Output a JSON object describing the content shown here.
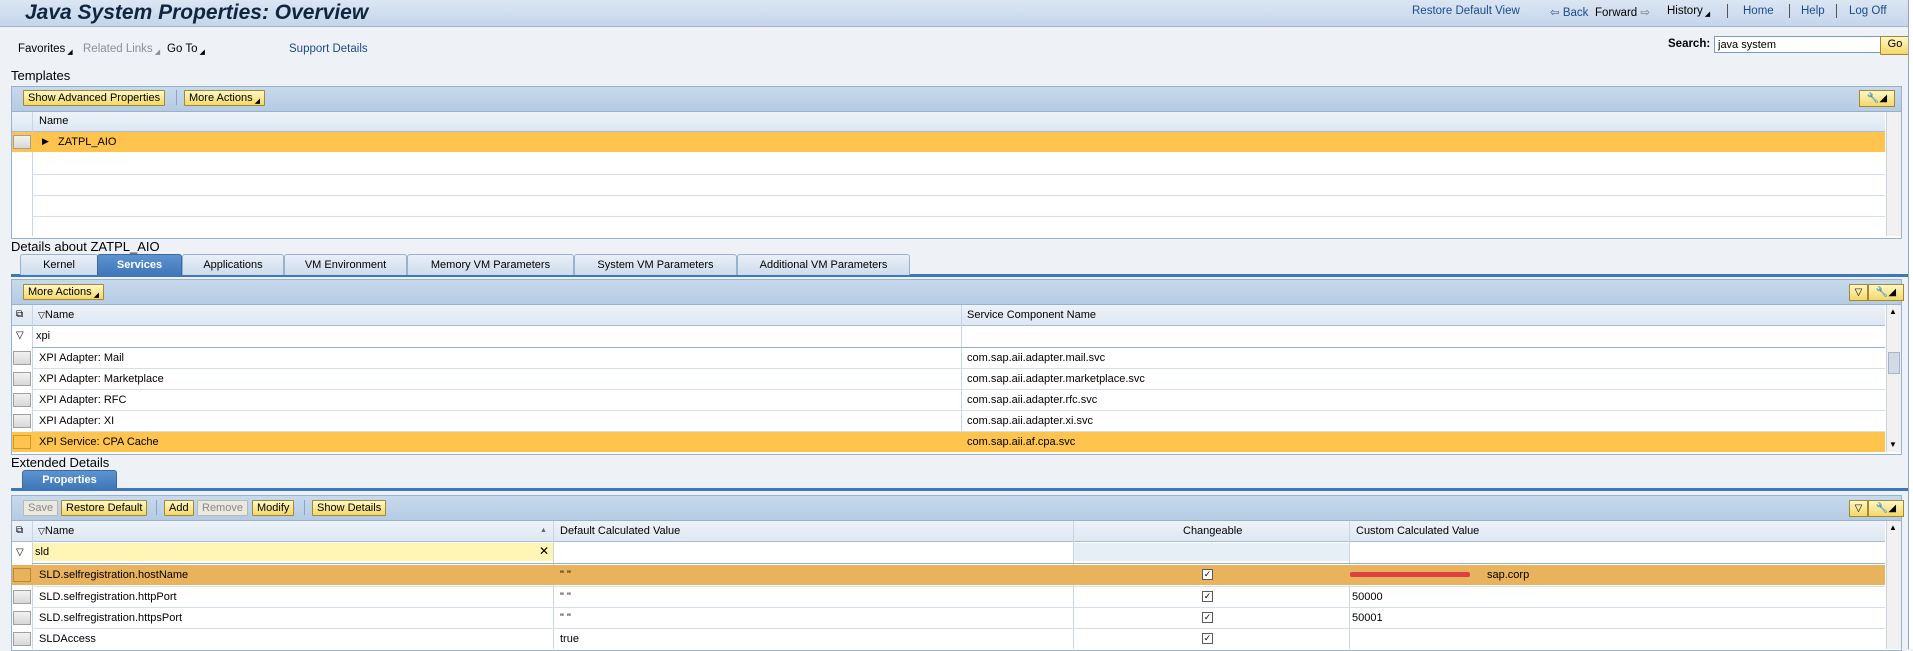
{
  "header": {
    "title": "Java System Properties: Overview",
    "links": {
      "restore_default_view": "Restore Default View",
      "back": "Back",
      "forward": "Forward",
      "history": "History",
      "home": "Home",
      "help": "Help",
      "log_off": "Log Off"
    }
  },
  "menu": {
    "favorites": "Favorites",
    "related_links": "Related Links",
    "go_to": "Go To",
    "support_details": "Support Details"
  },
  "search": {
    "label": "Search:",
    "value": "java system",
    "go_label": "Go"
  },
  "templates": {
    "title": "Templates",
    "show_advanced_label": "Show Advanced Properties",
    "more_actions_label": "More Actions",
    "column_name": "Name",
    "rows": [
      {
        "name": "ZATPL_AIO",
        "selected": true
      }
    ]
  },
  "details": {
    "title": "Details about ZATPL_AIO",
    "tabs": [
      {
        "label": "Kernel",
        "active": false
      },
      {
        "label": "Services",
        "active": true
      },
      {
        "label": "Applications",
        "active": false
      },
      {
        "label": "VM Environment",
        "active": false
      },
      {
        "label": "Memory VM Parameters",
        "active": false
      },
      {
        "label": "System VM Parameters",
        "active": false
      },
      {
        "label": "Additional VM Parameters",
        "active": false
      }
    ],
    "more_actions_label": "More Actions",
    "columns": {
      "name": "Name",
      "component": "Service Component Name"
    },
    "filter_value": "xpi",
    "rows": [
      {
        "name": "XPI Adapter: Mail",
        "component": "com.sap.aii.adapter.mail.svc",
        "selected": false
      },
      {
        "name": "XPI Adapter: Marketplace",
        "component": "com.sap.aii.adapter.marketplace.svc",
        "selected": false
      },
      {
        "name": "XPI Adapter: RFC",
        "component": "com.sap.aii.adapter.rfc.svc",
        "selected": false
      },
      {
        "name": "XPI Adapter: XI",
        "component": "com.sap.aii.adapter.xi.svc",
        "selected": false
      },
      {
        "name": "XPI Service: CPA Cache",
        "component": "com.sap.aii.af.cpa.svc",
        "selected": true
      }
    ]
  },
  "extended": {
    "title": "Extended Details",
    "tab_label": "Properties",
    "buttons": {
      "save": "Save",
      "restore_default": "Restore Default",
      "add": "Add",
      "remove": "Remove",
      "modify": "Modify",
      "show_details": "Show Details"
    },
    "columns": {
      "name": "Name",
      "default_value": "Default Calculated Value",
      "changeable": "Changeable",
      "custom_value": "Custom Calculated Value"
    },
    "filter_value": "sld",
    "rows": [
      {
        "name": "SLD.selfregistration.hostName",
        "default_value": "\" \"",
        "changeable": true,
        "custom_value": "sap.corp",
        "selected": true
      },
      {
        "name": "SLD.selfregistration.httpPort",
        "default_value": "\" \"",
        "changeable": true,
        "custom_value": "50000",
        "selected": false
      },
      {
        "name": "SLD.selfregistration.httpsPort",
        "default_value": "\" \"",
        "changeable": true,
        "custom_value": "50001",
        "selected": false
      },
      {
        "name": "SLDAccess",
        "default_value": "true",
        "changeable": true,
        "custom_value": "",
        "selected": false
      }
    ]
  },
  "colors": {
    "selection": "#ffc44d",
    "header_bg": "#c5d6ea",
    "active_tab": "#3f77b9",
    "button": "#f4d866",
    "redaction": "#e04040"
  }
}
